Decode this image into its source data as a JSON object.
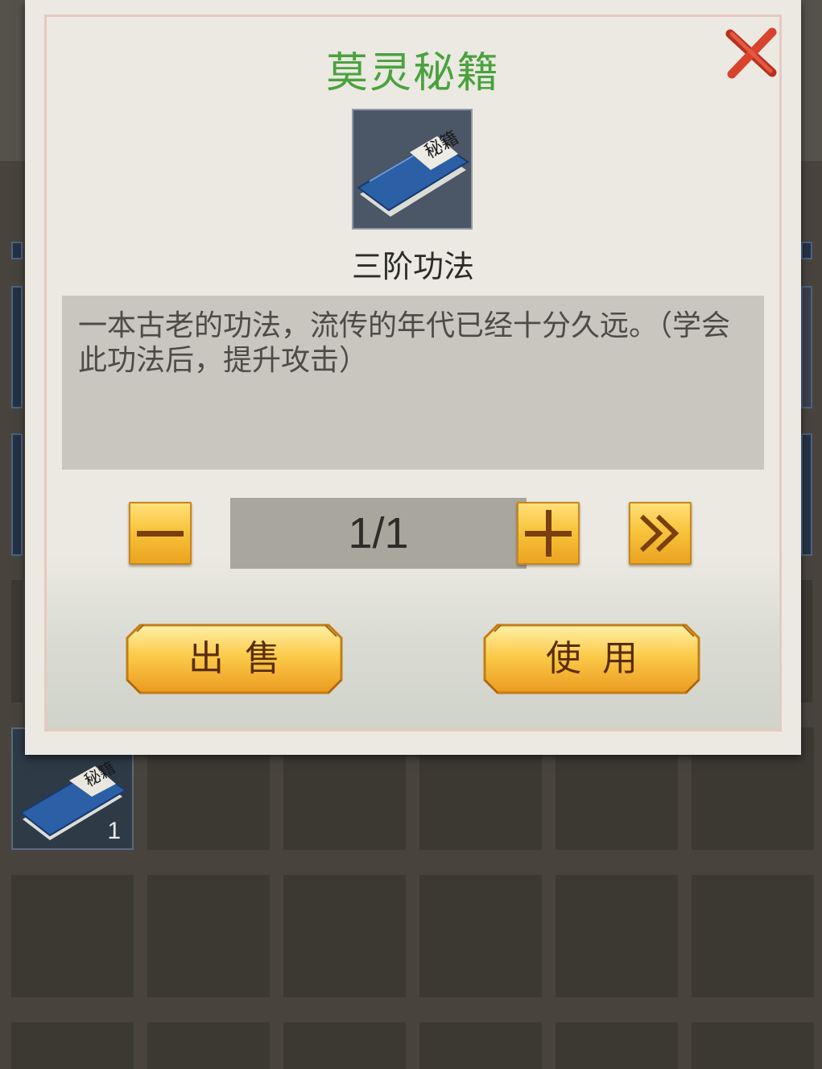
{
  "dialog": {
    "title": "莫灵秘籍",
    "item_name": "三阶功法",
    "book_cover_text": "秘籍",
    "description": "一本古老的功法，流传的年代已经十分久远。（学会此功法后，提升攻击）",
    "quantity": "1/1",
    "sell_label": "出售",
    "use_label": "使用"
  },
  "inventory": {
    "book_count": "1"
  },
  "colors": {
    "title": "#4aa23e",
    "button_gold": "#f8c43c",
    "close_red": "#d8432e"
  },
  "icons": [
    "close-icon",
    "minus-icon",
    "plus-icon",
    "max-icon",
    "book-icon"
  ]
}
